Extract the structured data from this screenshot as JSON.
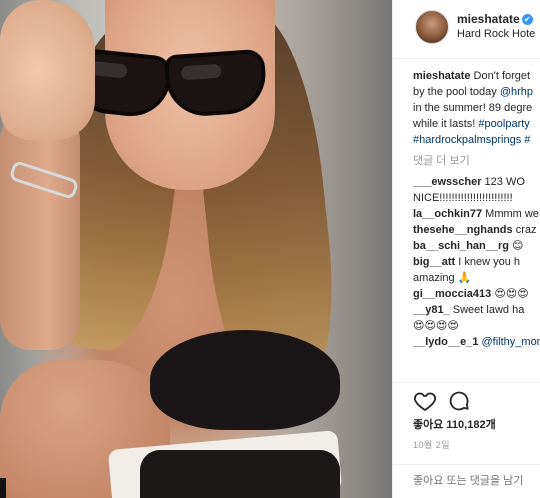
{
  "post": {
    "username": "mieshatate",
    "location": "Hard Rock Hote",
    "verified_icon": "verified-badge-icon",
    "caption": {
      "user": "mieshatate",
      "line1": "Don't forget",
      "line2_prefix": "by the pool today ",
      "line2_mention": "@hrhp",
      "line3": "in the summer! 89 degre",
      "line4_prefix": "while it lasts! ",
      "line4_tag": "#poolparty",
      "line5": "#hardrockpalmsprings #"
    },
    "more_comments": "댓글 더 보기",
    "comments": [
      {
        "user": "___ewsscher",
        "text": " 123 WO"
      },
      {
        "user": "",
        "text": "NICE!!!!!!!!!!!!!!!!!!!!!!!!"
      },
      {
        "user": "la__ochkin77",
        "text": " Mmmm we"
      },
      {
        "user": "thesehe__nghands",
        "text": " craz"
      },
      {
        "user": "ba__schi_han__rg",
        "text": " 😊"
      },
      {
        "user": "big__att",
        "text": " I knew you h"
      },
      {
        "user": "",
        "text": "amazing 🙏"
      },
      {
        "user": "gi__moccia413",
        "text": " 😍😍😍"
      },
      {
        "user": "__y81_",
        "text": " Sweet lawd ha"
      },
      {
        "user": "",
        "text": "😍😍😍😍"
      },
      {
        "user": "__lydo__e_1",
        "text": " ",
        "mention": "@filthy_mom"
      }
    ],
    "likes": "좋아요 110,182개",
    "date": "10월 2일",
    "add_comment_placeholder": "좋아요 또는 댓글을 남기"
  },
  "colors": {
    "verified": "#3897f0",
    "link": "#003569",
    "text": "#262626",
    "muted": "#999999"
  },
  "icons": {
    "like": "heart-outline-icon",
    "comment": "comment-bubble-icon"
  }
}
